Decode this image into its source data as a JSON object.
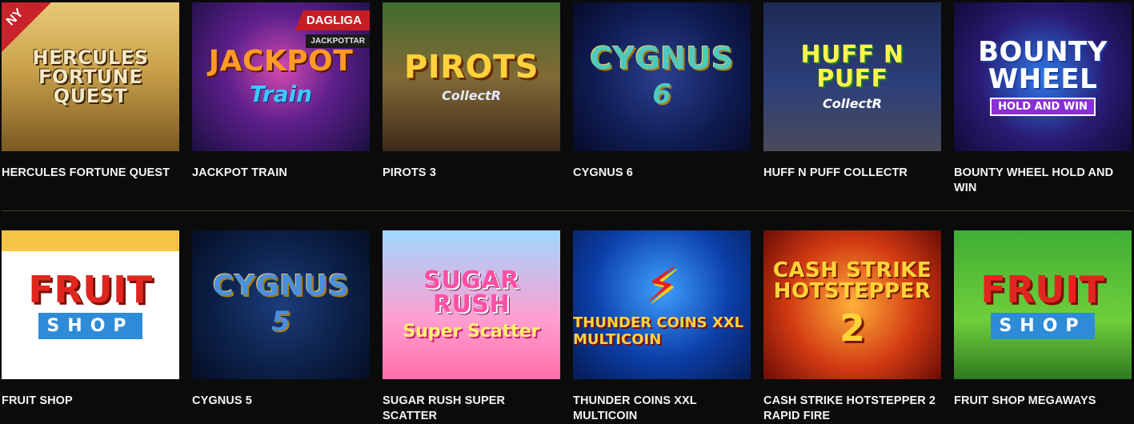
{
  "games_row_1": [
    {
      "label": "HERCULES FORTUNE QUEST",
      "art_title": "Hercules Fortune Quest",
      "art_sub": "",
      "ribbon": "NY"
    },
    {
      "label": "JACKPOT TRAIN",
      "art_title": "Jackpot",
      "art_sub": "Train",
      "badge": "DAGLIGA",
      "badge_sub": "JACKPOTTAR"
    },
    {
      "label": "PIROTS 3",
      "art_title": "Pirots",
      "art_sub": "CollectR"
    },
    {
      "label": "CYGNUS 6",
      "art_title": "Cygnus",
      "art_sub": "6"
    },
    {
      "label": "HUFF N PUFF COLLECTR",
      "art_title": "Huff n Puff",
      "art_sub": "CollectR"
    },
    {
      "label": "BOUNTY WHEEL HOLD AND WIN",
      "art_title": "Bounty Wheel",
      "art_sub": "HOLD AND WIN"
    }
  ],
  "games_row_2": [
    {
      "label": "FRUIT SHOP",
      "art_title": "Fruit",
      "art_sub": "SHOP"
    },
    {
      "label": "CYGNUS 5",
      "art_title": "Cygnus",
      "art_sub": "5"
    },
    {
      "label": "SUGAR RUSH SUPER SCATTER",
      "art_title": "Sugar Rush",
      "art_sub": "Super Scatter"
    },
    {
      "label": "THUNDER COINS XXL MULTICOIN",
      "art_title": "⚡",
      "art_sub": "THUNDER COINS XXL MULTICOIN"
    },
    {
      "label": "CASH STRIKE HOTSTEPPER 2 RAPID FIRE",
      "art_title": "Cash Strike Hotstepper",
      "art_sub": "2"
    },
    {
      "label": "FRUIT SHOP MEGAWAYS",
      "art_title": "Fruit",
      "art_sub": "SHOP"
    }
  ],
  "colors": {
    "background": "#0b0b0b",
    "divider": "#4a3d22",
    "label_text": "#f4f4f4",
    "badge_red": "#c61d25"
  }
}
